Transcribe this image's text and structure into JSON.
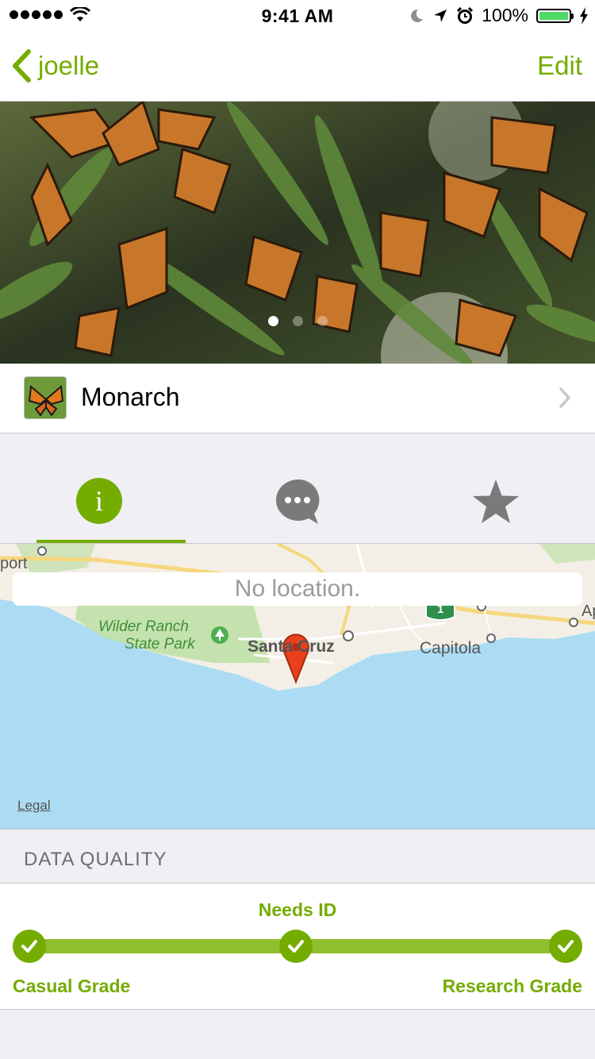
{
  "status_bar": {
    "time": "9:41 AM",
    "battery": "100%"
  },
  "nav": {
    "back_label": "joelle",
    "edit_label": "Edit"
  },
  "photo": {
    "page_count": 3,
    "current_page": 1
  },
  "taxon": {
    "name": "Monarch"
  },
  "tabs": [
    {
      "id": "info",
      "icon": "info-icon",
      "active": true
    },
    {
      "id": "activity",
      "icon": "comment-icon",
      "active": false
    },
    {
      "id": "faves",
      "icon": "star-icon",
      "active": false
    }
  ],
  "map": {
    "banner": "No location.",
    "labels": {
      "port": "port",
      "wilder_line1": "Wilder Ranch",
      "wilder_line2": "State Park",
      "santa_cruz": "Santa Cruz",
      "capitola": "Capitola",
      "ap": "Ap",
      "highway": "1"
    },
    "legal": "Legal"
  },
  "data_quality": {
    "header": "DATA QUALITY",
    "needs_id": "Needs ID",
    "casual": "Casual Grade",
    "research": "Research Grade"
  },
  "colors": {
    "accent": "#74ac00",
    "water": "#abdcf3",
    "pin": "#e8401c"
  }
}
